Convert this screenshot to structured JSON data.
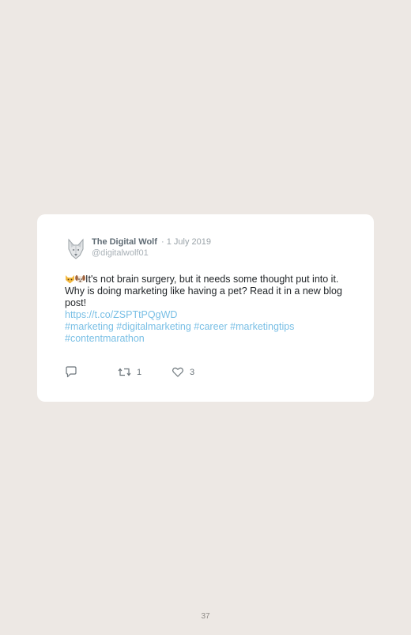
{
  "tweet": {
    "author_name": "The Digital Wolf",
    "separator": "·",
    "date": "1 July 2019",
    "handle": "@digitalwolf01",
    "body_text": "It's not brain surgery, but it needs some thought put into it. Why is doing marketing like having a pet? Read it in a new blog post!",
    "emojis": [
      "cat-face-emoji",
      "dog-face-emoji"
    ],
    "link": "https://t.co/ZSPTtPQgWD",
    "hashtags_line1": "#marketing #digitalmarketing #career #marketingtips",
    "hashtags_line2": "#contentmarathon",
    "actions": {
      "reply_icon": "reply-icon",
      "retweet_icon": "retweet-icon",
      "retweet_count": "1",
      "like_icon": "heart-icon",
      "like_count": "3"
    }
  },
  "page": {
    "number": "37"
  },
  "colors": {
    "background": "#ede8e4",
    "card": "#ffffff",
    "link": "#79bfe5",
    "text": "#1f2326"
  }
}
